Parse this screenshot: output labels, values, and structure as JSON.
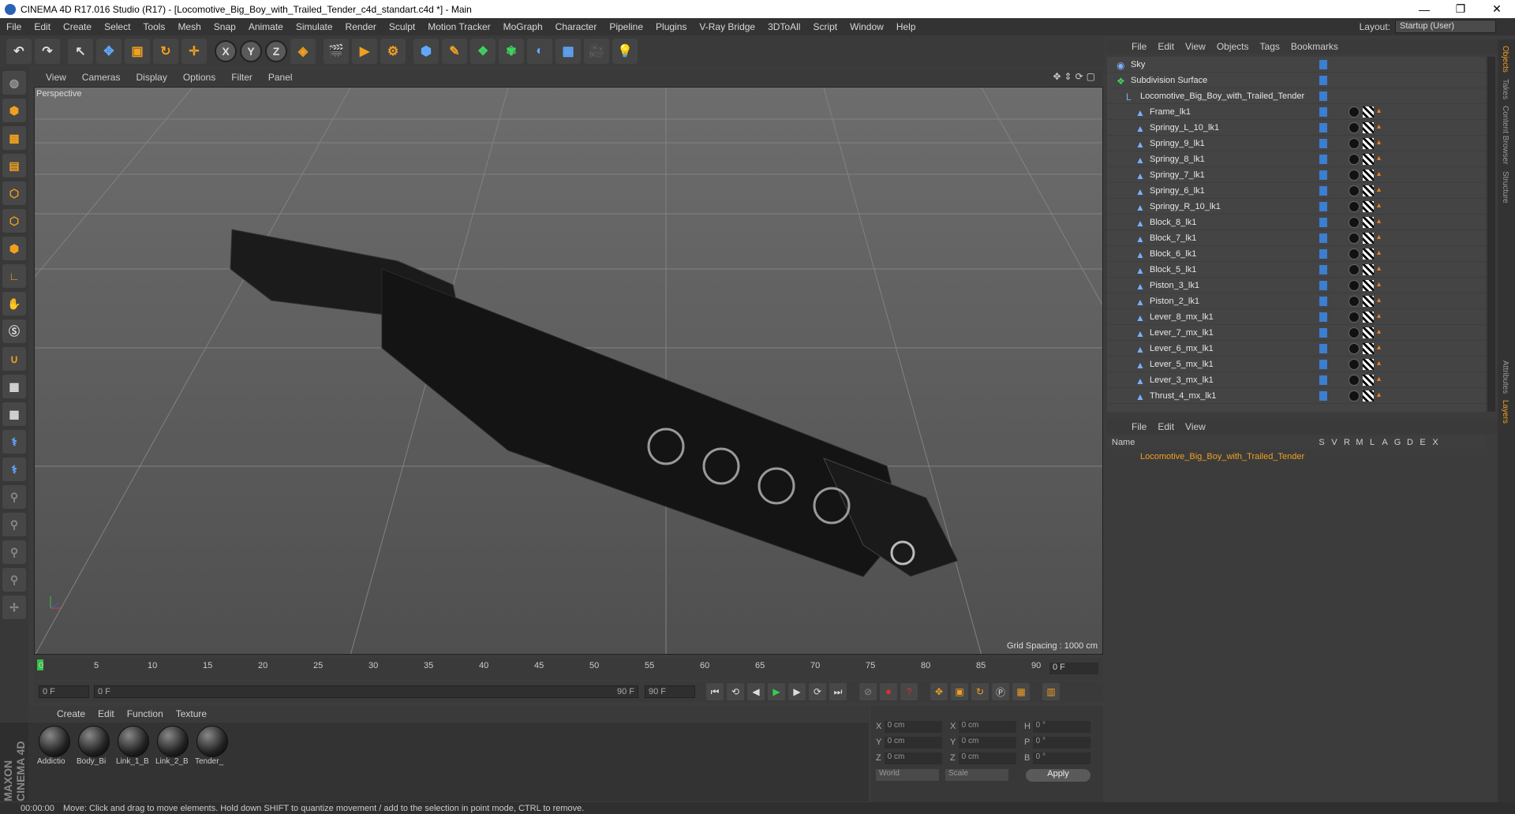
{
  "window": {
    "title": "CINEMA 4D R17.016 Studio (R17) - [Locomotive_Big_Boy_with_Trailed_Tender_c4d_standart.c4d *] - Main"
  },
  "menu": [
    "File",
    "Edit",
    "Create",
    "Select",
    "Tools",
    "Mesh",
    "Snap",
    "Animate",
    "Simulate",
    "Render",
    "Sculpt",
    "Motion Tracker",
    "MoGraph",
    "Character",
    "Pipeline",
    "Plugins",
    "V-Ray Bridge",
    "3DToAll",
    "Script",
    "Window",
    "Help"
  ],
  "layout": {
    "label": "Layout:",
    "value": "Startup (User)"
  },
  "toolbar": {
    "x": "X",
    "y": "Y",
    "z": "Z"
  },
  "viewport": {
    "menu": [
      "View",
      "Cameras",
      "Display",
      "Options",
      "Filter",
      "Panel"
    ],
    "label": "Perspective",
    "grid_spacing": "Grid Spacing : 1000 cm"
  },
  "timeline": {
    "ticks": [
      "0",
      "5",
      "10",
      "15",
      "20",
      "25",
      "30",
      "35",
      "40",
      "45",
      "50",
      "55",
      "60",
      "65",
      "70",
      "75",
      "80",
      "85",
      "90"
    ],
    "frame": "0 F",
    "start": "0 F",
    "range_start": "0 F",
    "range_end": "90 F",
    "end": "90 F"
  },
  "materials": {
    "menu": [
      "Create",
      "Edit",
      "Function",
      "Texture"
    ],
    "items": [
      "Addictio",
      "Body_Bi",
      "Link_1_B",
      "Link_2_B",
      "Tender_"
    ]
  },
  "coords": {
    "rows": [
      {
        "a": "X",
        "av": "0 cm",
        "b": "X",
        "bv": "0 cm",
        "c": "H",
        "cv": "0 °"
      },
      {
        "a": "Y",
        "av": "0 cm",
        "b": "Y",
        "bv": "0 cm",
        "c": "P",
        "cv": "0 °"
      },
      {
        "a": "Z",
        "av": "0 cm",
        "b": "Z",
        "bv": "0 cm",
        "c": "B",
        "cv": "0 °"
      }
    ],
    "world": "World",
    "scale": "Scale",
    "apply": "Apply"
  },
  "status": {
    "time": "00:00:00",
    "message": "Move: Click and drag to move elements. Hold down SHIFT to quantize movement / add to the selection in point mode, CTRL to remove."
  },
  "objects": {
    "menu": [
      "File",
      "Edit",
      "View",
      "Objects",
      "Tags",
      "Bookmarks"
    ],
    "items": [
      {
        "name": "Sky",
        "indent": 0
      },
      {
        "name": "Subdivision Surface",
        "indent": 0
      },
      {
        "name": "Locomotive_Big_Boy_with_Trailed_Tender",
        "indent": 1
      },
      {
        "name": "Frame_lk1",
        "indent": 2
      },
      {
        "name": "Springy_L_10_lk1",
        "indent": 2
      },
      {
        "name": "Springy_9_lk1",
        "indent": 2
      },
      {
        "name": "Springy_8_lk1",
        "indent": 2
      },
      {
        "name": "Springy_7_lk1",
        "indent": 2
      },
      {
        "name": "Springy_6_lk1",
        "indent": 2
      },
      {
        "name": "Springy_R_10_lk1",
        "indent": 2
      },
      {
        "name": "Block_8_lk1",
        "indent": 2
      },
      {
        "name": "Block_7_lk1",
        "indent": 2
      },
      {
        "name": "Block_6_lk1",
        "indent": 2
      },
      {
        "name": "Block_5_lk1",
        "indent": 2
      },
      {
        "name": "Piston_3_lk1",
        "indent": 2
      },
      {
        "name": "Piston_2_lk1",
        "indent": 2
      },
      {
        "name": "Lever_8_mx_lk1",
        "indent": 2
      },
      {
        "name": "Lever_7_mx_lk1",
        "indent": 2
      },
      {
        "name": "Lever_6_mx_lk1",
        "indent": 2
      },
      {
        "name": "Lever_5_mx_lk1",
        "indent": 2
      },
      {
        "name": "Lever_3_mx_lk1",
        "indent": 2
      },
      {
        "name": "Thrust_4_mx_lk1",
        "indent": 2
      }
    ]
  },
  "layers": {
    "menu": [
      "File",
      "Edit",
      "View"
    ],
    "header": {
      "name": "Name",
      "cols": [
        "S",
        "V",
        "R",
        "M",
        "L",
        "A",
        "G",
        "D",
        "E",
        "X"
      ]
    },
    "row": "Locomotive_Big_Boy_with_Trailed_Tender"
  },
  "right_tabs": [
    "Objects",
    "Takes",
    "Content Browser",
    "Structure",
    "Attributes",
    "Layers"
  ]
}
